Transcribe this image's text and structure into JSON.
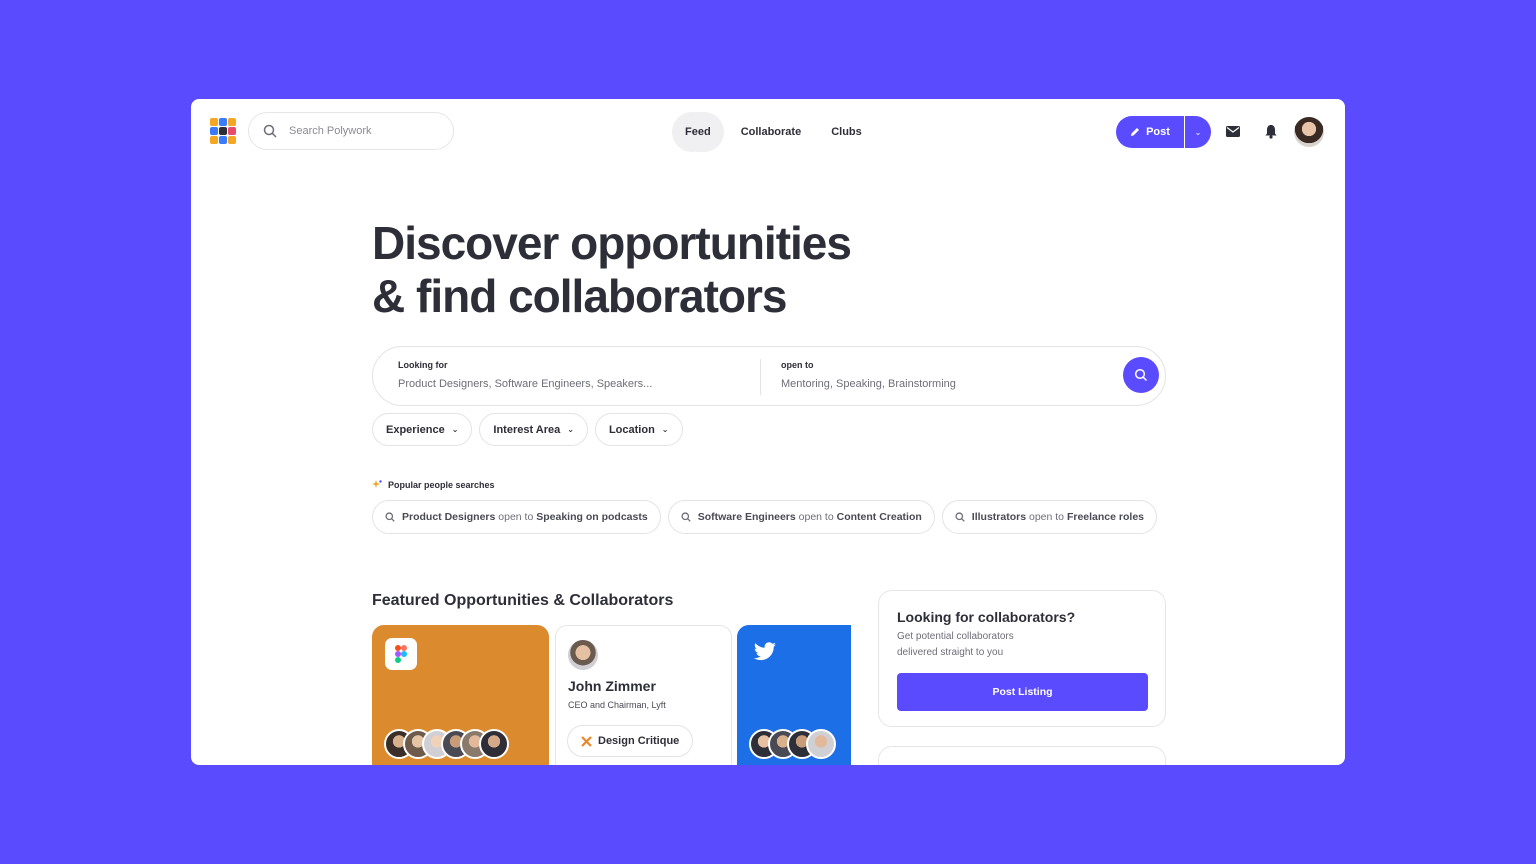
{
  "search": {
    "placeholder": "Search Polywork"
  },
  "nav": [
    {
      "label": "Feed"
    },
    {
      "label": "Collaborate"
    },
    {
      "label": "Clubs"
    }
  ],
  "actions": {
    "post_label": "Post"
  },
  "hero": {
    "title_line1": "Discover opportunities",
    "title_line2": "& find collaborators"
  },
  "finder": {
    "looking_label": "Looking for",
    "looking_value": "Product Designers, Software Engineers, Speakers...",
    "open_label": "open to",
    "open_value": "Mentoring, Speaking, Brainstorming"
  },
  "filters": [
    {
      "label": "Experience"
    },
    {
      "label": "Interest Area"
    },
    {
      "label": "Location"
    }
  ],
  "popular": {
    "label": "Popular people searches",
    "connector": "open to",
    "items": [
      {
        "who": "Product Designers",
        "what": "Speaking on podcasts"
      },
      {
        "who": "Software Engineers",
        "what": "Content Creation"
      },
      {
        "who": "Illustrators",
        "what": "Freelance roles"
      }
    ]
  },
  "featured": {
    "title": "Featured Opportunities & Collaborators",
    "person": {
      "name": "John Zimmer",
      "role": "CEO and Chairman, Lyft",
      "tag": "Design Critique"
    }
  },
  "sidebar": {
    "title": "Looking for collaborators?",
    "subtitle": "Get potential collaborators delivered straight to you",
    "button": "Post Listing"
  },
  "colors": {
    "accent": "#5b4bff",
    "figma_card": "#dc8a2e",
    "twitter_card": "#1d6fe8"
  }
}
